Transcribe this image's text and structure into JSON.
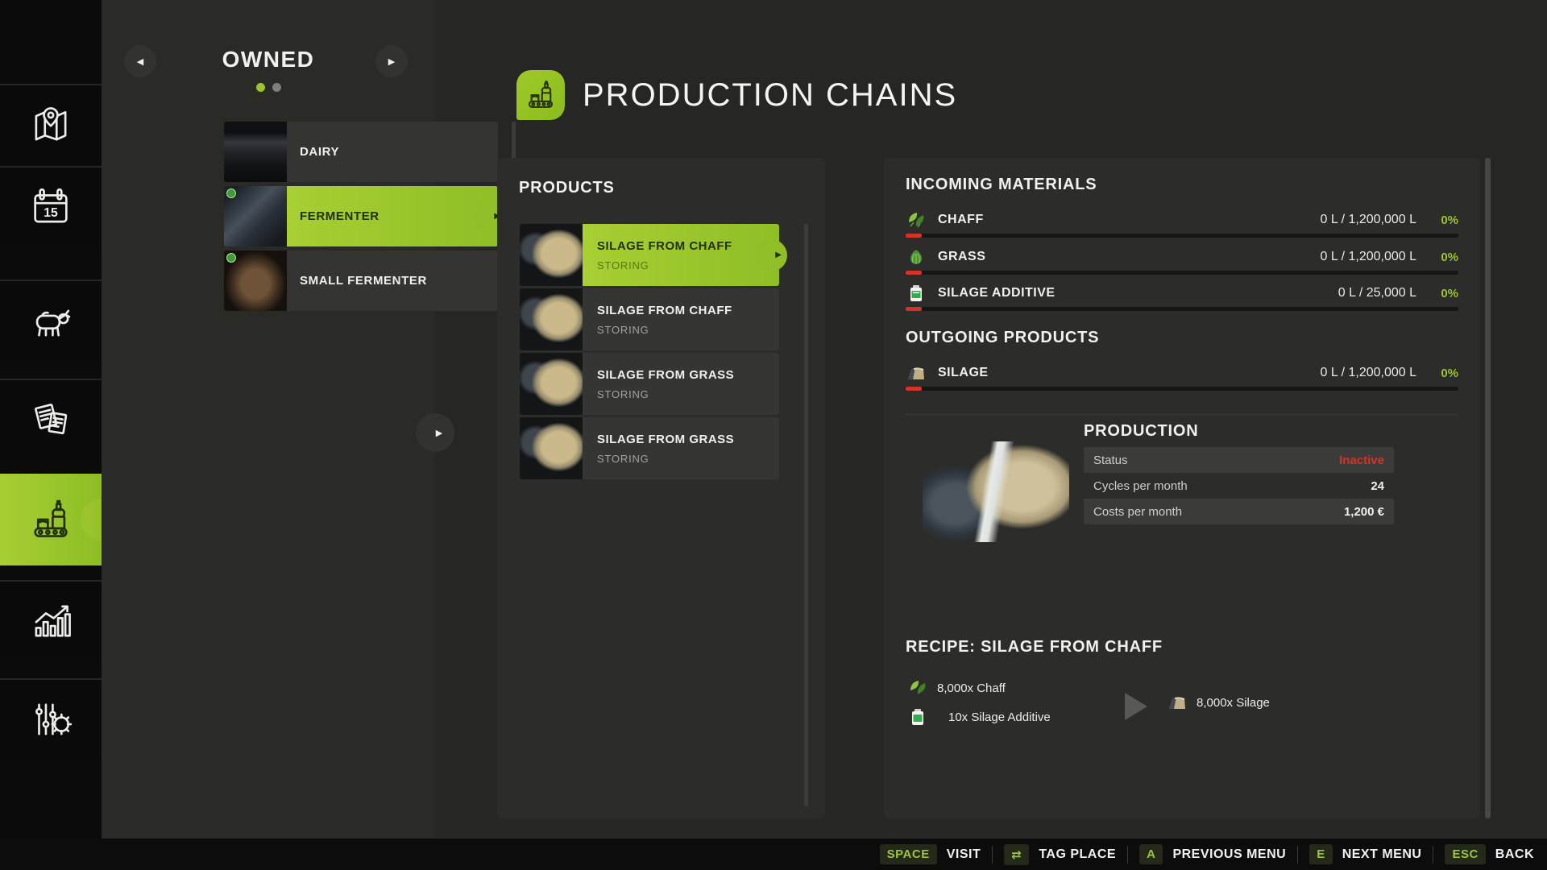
{
  "colors": {
    "accent_green": "#9ac52e",
    "selected_gradient_start": "#a8cf33",
    "selected_gradient_end": "#8fbe26",
    "status_red": "#d2342a",
    "key_green": "#9bc53d",
    "panel_bg": "#2c2c2a",
    "sidebar_bg": "#0b0b0b"
  },
  "sidebar": {
    "items": [
      {
        "icon": "map-icon"
      },
      {
        "icon": "calendar-icon",
        "calendar_day": "15"
      },
      {
        "icon": "animals-icon"
      },
      {
        "icon": "contracts-icon"
      },
      {
        "icon": "production-chains-icon",
        "selected": true
      },
      {
        "icon": "statistics-icon"
      },
      {
        "icon": "settings-icon"
      }
    ]
  },
  "owned_panel": {
    "title": "OWNED",
    "prev_arrow": "◀",
    "next_arrow": "▶",
    "pagination": {
      "dot_count": 2,
      "active_index": 0
    },
    "items": [
      {
        "label": "DAIRY",
        "selected": false
      },
      {
        "label": "FERMENTER",
        "selected": true,
        "arrow": "▶"
      },
      {
        "label": "SMALL FERMENTER",
        "selected": false
      }
    ],
    "expand_arrow": "▶"
  },
  "header": {
    "title": "PRODUCTION CHAINS",
    "icon": "production-chains-icon"
  },
  "products_panel": {
    "title": "PRODUCTS",
    "items": [
      {
        "title": "SILAGE FROM CHAFF",
        "status": "STORING",
        "selected": true
      },
      {
        "title": "SILAGE FROM CHAFF",
        "status": "STORING",
        "selected": false
      },
      {
        "title": "SILAGE FROM GRASS",
        "status": "STORING",
        "selected": false
      },
      {
        "title": "SILAGE FROM GRASS",
        "status": "STORING",
        "selected": false
      }
    ]
  },
  "details_panel": {
    "incoming": {
      "title": "INCOMING MATERIALS",
      "rows": [
        {
          "icon": "chaff-icon",
          "name": "CHAFF",
          "value": "0 L / 1,200,000 L",
          "percent": "0%"
        },
        {
          "icon": "grass-icon",
          "name": "GRASS",
          "value": "0 L / 1,200,000 L",
          "percent": "0%"
        },
        {
          "icon": "silage-additive-icon",
          "name": "SILAGE ADDITIVE",
          "value": "0 L / 25,000 L",
          "percent": "0%"
        }
      ]
    },
    "outgoing": {
      "title": "OUTGOING PRODUCTS",
      "rows": [
        {
          "icon": "silage-icon",
          "name": "SILAGE",
          "value": "0 L / 1,200,000 L",
          "percent": "0%"
        }
      ]
    },
    "production": {
      "title": "PRODUCTION",
      "rows": [
        {
          "label": "Status",
          "value": "Inactive",
          "red": true
        },
        {
          "label": "Cycles per month",
          "value": "24"
        },
        {
          "label": "Costs per month",
          "value": "1,200 €"
        }
      ]
    },
    "recipe": {
      "title": "RECIPE: SILAGE FROM CHAFF",
      "inputs": [
        {
          "icon": "chaff-icon",
          "qty": "8,000x Chaff"
        },
        {
          "icon": "silage-additive-icon",
          "qty": "10x Silage Additive"
        }
      ],
      "outputs": [
        {
          "icon": "silage-icon",
          "qty": "8,000x Silage"
        }
      ]
    }
  },
  "bottom_bar": {
    "actions": [
      {
        "key": "SPACE",
        "label": "VISIT"
      },
      {
        "key": "⇄",
        "label": "TAG PLACE"
      },
      {
        "key": "A",
        "label": "PREVIOUS MENU"
      },
      {
        "key": "E",
        "label": "NEXT MENU"
      },
      {
        "key": "ESC",
        "label": "BACK"
      }
    ]
  }
}
